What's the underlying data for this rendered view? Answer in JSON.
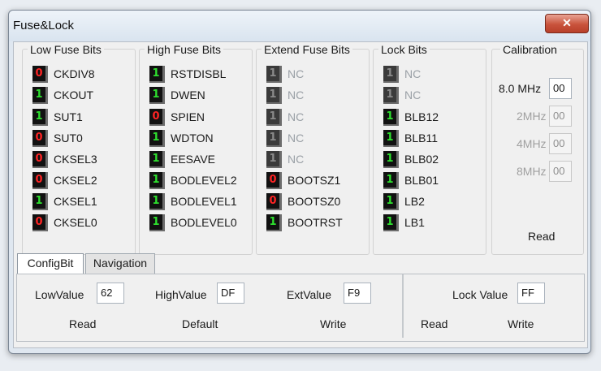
{
  "window": {
    "title": "Fuse&Lock",
    "close_glyph": "✕"
  },
  "groups": {
    "low": {
      "title": "Low Fuse Bits",
      "bits": [
        {
          "value": "0",
          "name": "CKDIV8",
          "state": "zero"
        },
        {
          "value": "1",
          "name": "CKOUT",
          "state": "one"
        },
        {
          "value": "1",
          "name": "SUT1",
          "state": "one"
        },
        {
          "value": "0",
          "name": "SUT0",
          "state": "zero"
        },
        {
          "value": "0",
          "name": "CKSEL3",
          "state": "zero"
        },
        {
          "value": "0",
          "name": "CKSEL2",
          "state": "zero"
        },
        {
          "value": "1",
          "name": "CKSEL1",
          "state": "one"
        },
        {
          "value": "0",
          "name": "CKSEL0",
          "state": "zero"
        }
      ]
    },
    "high": {
      "title": "High Fuse Bits",
      "bits": [
        {
          "value": "1",
          "name": "RSTDISBL",
          "state": "one"
        },
        {
          "value": "1",
          "name": "DWEN",
          "state": "one"
        },
        {
          "value": "0",
          "name": "SPIEN",
          "state": "zero"
        },
        {
          "value": "1",
          "name": "WDTON",
          "state": "one"
        },
        {
          "value": "1",
          "name": "EESAVE",
          "state": "one"
        },
        {
          "value": "1",
          "name": "BODLEVEL2",
          "state": "one"
        },
        {
          "value": "1",
          "name": "BODLEVEL1",
          "state": "one"
        },
        {
          "value": "1",
          "name": "BODLEVEL0",
          "state": "one"
        }
      ]
    },
    "ext": {
      "title": "Extend Fuse Bits",
      "bits": [
        {
          "value": "1",
          "name": "NC",
          "state": "dis"
        },
        {
          "value": "1",
          "name": "NC",
          "state": "dis"
        },
        {
          "value": "1",
          "name": "NC",
          "state": "dis"
        },
        {
          "value": "1",
          "name": "NC",
          "state": "dis"
        },
        {
          "value": "1",
          "name": "NC",
          "state": "dis"
        },
        {
          "value": "0",
          "name": "BOOTSZ1",
          "state": "zero"
        },
        {
          "value": "0",
          "name": "BOOTSZ0",
          "state": "zero"
        },
        {
          "value": "1",
          "name": "BOOTRST",
          "state": "one"
        }
      ]
    },
    "lock": {
      "title": "Lock Bits",
      "bits": [
        {
          "value": "1",
          "name": "NC",
          "state": "dis"
        },
        {
          "value": "1",
          "name": "NC",
          "state": "dis"
        },
        {
          "value": "1",
          "name": "BLB12",
          "state": "one"
        },
        {
          "value": "1",
          "name": "BLB11",
          "state": "one"
        },
        {
          "value": "1",
          "name": "BLB02",
          "state": "one"
        },
        {
          "value": "1",
          "name": "BLB01",
          "state": "one"
        },
        {
          "value": "1",
          "name": "LB2",
          "state": "one"
        },
        {
          "value": "1",
          "name": "LB1",
          "state": "one"
        }
      ]
    }
  },
  "calibration": {
    "title": "Calibration",
    "rows": [
      {
        "label": "8.0 MHz",
        "value": "00",
        "enabled": true
      },
      {
        "label": "2MHz",
        "value": "00",
        "enabled": false
      },
      {
        "label": "4MHz",
        "value": "00",
        "enabled": false
      },
      {
        "label": "8MHz",
        "value": "00",
        "enabled": false
      }
    ],
    "read_label": "Read"
  },
  "tabs": {
    "configbit": "ConfigBit",
    "navigation": "Navigation"
  },
  "config": {
    "low_label": "LowValue",
    "low_value": "62",
    "high_label": "HighValue",
    "high_value": "DF",
    "ext_label": "ExtValue",
    "ext_value": "F9",
    "lock_label": "Lock Value",
    "lock_value": "FF",
    "read_label": "Read",
    "default_label": "Default",
    "write_label": "Write",
    "lock_read_label": "Read",
    "lock_write_label": "Write"
  },
  "colors": {
    "bit_one": "#2ee02e",
    "bit_zero": "#ff2424",
    "bit_disabled": "#8a8a8a"
  }
}
